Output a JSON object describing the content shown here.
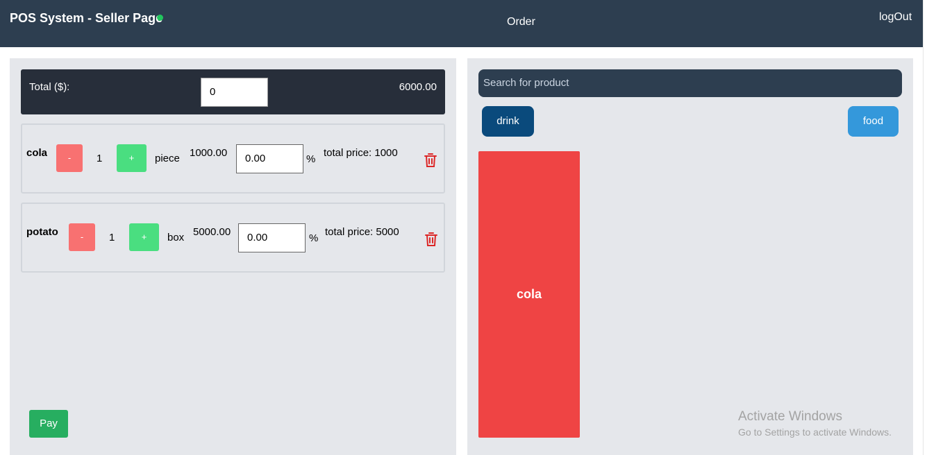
{
  "header": {
    "title": "POS System - Seller Page",
    "status_color": "#22c55e",
    "nav_order": "Order",
    "logout": "logOut"
  },
  "cart": {
    "total_label": "Total ($):",
    "total_input_value": "0",
    "total_amount": "6000.00",
    "items": [
      {
        "name": "cola",
        "minus": "-",
        "quantity": "1",
        "plus": "+",
        "unit": "piece",
        "unit_price": "1000.00",
        "discount": "0.00",
        "discount_symbol": "%",
        "total_price": "total price: 1000",
        "delete_icon": "trash-icon"
      },
      {
        "name": "potato",
        "minus": "-",
        "quantity": "1",
        "plus": "+",
        "unit": "box",
        "unit_price": "5000.00",
        "discount": "0.00",
        "discount_symbol": "%",
        "total_price": "total price: 5000",
        "delete_icon": "trash-icon"
      }
    ],
    "pay_label": "Pay"
  },
  "products": {
    "search_placeholder": "Search for product",
    "categories": [
      "drink",
      "food"
    ],
    "items": [
      "cola"
    ]
  },
  "watermark": {
    "title": "Activate Windows",
    "subtitle": "Go to Settings to activate Windows."
  },
  "colors": {
    "header_bg": "#2d3e50",
    "panel_bg": "#e5e7eb",
    "minus_btn": "#f87171",
    "plus_btn": "#4ade80",
    "pay_btn": "#27ae60",
    "drink_btn": "#0a4a7c",
    "food_btn": "#3498db",
    "product_card": "#ef4444",
    "trash_icon": "#dc2626"
  }
}
